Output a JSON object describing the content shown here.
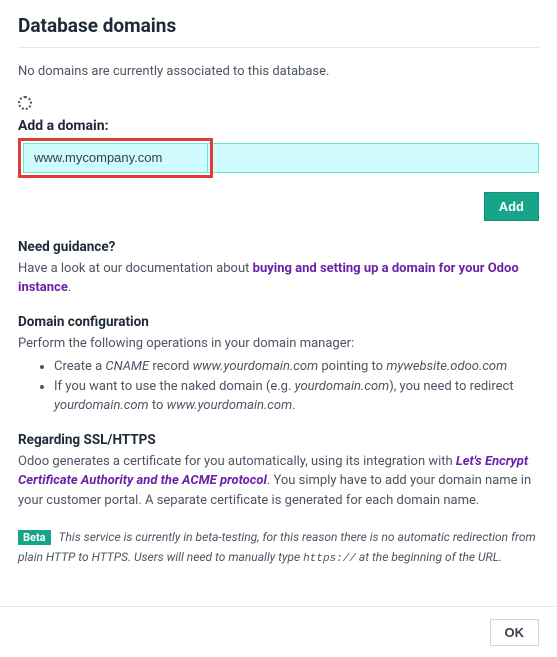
{
  "title": "Database domains",
  "no_domains_text": "No domains are currently associated to this database.",
  "add_domain_label": "Add a domain:",
  "domain_input_value": "www.mycompany.com",
  "add_button": "Add",
  "guidance": {
    "heading": "Need guidance?",
    "prefix": "Have a look at our documentation about ",
    "link": "buying and setting up a domain for your Odoo instance",
    "suffix": "."
  },
  "config": {
    "heading": "Domain configuration",
    "intro": "Perform the following operations in your domain manager:",
    "bullet1_prefix": "Create a ",
    "bullet1_cname": "CNAME",
    "bullet1_mid1": " record ",
    "bullet1_domain1": "www.yourdomain.com",
    "bullet1_mid2": " pointing to ",
    "bullet1_domain2": "mywebsite.odoo.com",
    "bullet2_prefix": "If you want to use the naked domain (e.g. ",
    "bullet2_domain1": "yourdomain.com",
    "bullet2_mid": "), you need to redirect ",
    "bullet2_domain2": "yourdomain.com",
    "bullet2_mid2": " to ",
    "bullet2_domain3": "www.yourdomain.com",
    "bullet2_suffix": "."
  },
  "ssl": {
    "heading": "Regarding SSL/HTTPS",
    "prefix": "Odoo generates a certificate for you automatically, using its integration with ",
    "link": "Let's Encrypt Certificate Authority and the ACME protocol",
    "suffix": ". You simply have to add your domain name in your customer portal. A separate certificate is generated for each domain name."
  },
  "beta": {
    "badge": "Beta",
    "text_prefix": "This service is currently in beta-testing, for this reason there is no automatic redirection from plain HTTP to HTTPS. Users will need to manually type ",
    "code": "https://",
    "text_suffix": " at the beginning of the URL."
  },
  "ok_button": "OK"
}
